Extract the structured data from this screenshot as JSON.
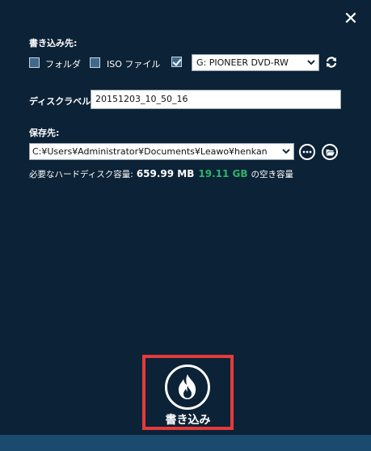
{
  "close_label": "✕",
  "write_to": {
    "label": "書き込み先:",
    "folder_label": "フォルダ",
    "folder_checked": false,
    "iso_label": "ISO ファイル",
    "iso_checked": false,
    "drive_checked": true,
    "drive_value": "G: PIONEER  DVD-RW"
  },
  "disc_label": {
    "label": "ディスクラベル:",
    "value": "20151203_10_50_16"
  },
  "save_to": {
    "label": "保存先:",
    "path": "C:¥Users¥Administrator¥Documents¥Leawo¥henkan"
  },
  "capacity": {
    "label": "必要なハードディスク容量:",
    "required": "659.99 MB",
    "free": "19.11 GB",
    "free_suffix": "の空き容量"
  },
  "burn_label": "書き込み",
  "colors": {
    "background": "#0c2236",
    "highlight_border": "#e53a3a",
    "free_space": "#2fb36a",
    "bottom_bar": "#1a4b6e"
  }
}
